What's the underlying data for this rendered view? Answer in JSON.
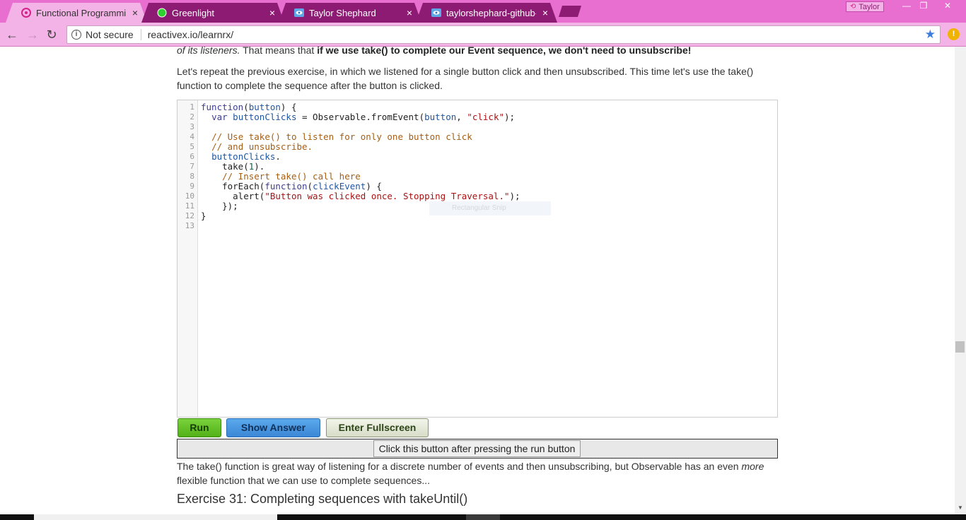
{
  "browser": {
    "tabs": [
      {
        "title": "Functional Programming",
        "active": true,
        "favicon": "reactivex-icon"
      },
      {
        "title": "Greenlight",
        "active": false,
        "favicon": "green-circle-icon"
      },
      {
        "title": "Taylor Shephard",
        "active": false,
        "favicon": "cloud-eye-icon"
      },
      {
        "title": "taylorshephard-github-io",
        "active": false,
        "favicon": "cloud-eye-icon"
      }
    ],
    "close_glyph": "×",
    "profile_name": "Taylor",
    "window_controls": {
      "minimize": "—",
      "restore": "❐",
      "close": "✕"
    },
    "security_label": "Not secure",
    "url": "reactivex.io/learnrx/",
    "colors": {
      "frame": "#e86fd0",
      "toolbar": "#f3b3e6",
      "inactive_tab": "#8e1b73"
    }
  },
  "page": {
    "top_paragraph": {
      "lead_italic": "of its listeners.",
      "middle": " That means that ",
      "bold": "if we use take() to complete our Event sequence, we don't need to unsubscribe!"
    },
    "intro": "Let's repeat the previous exercise, in which we listened for a single button click and then unsubscribed. This time let's use the take() function to complete the sequence after the button is clicked.",
    "editor": {
      "line_numbers": [
        "1",
        "2",
        "3",
        "4",
        "5",
        "6",
        "7",
        "8",
        "9",
        "10",
        "11",
        "12",
        "13"
      ],
      "overlay_text": "Rectangular Snip"
    },
    "buttons": {
      "run": "Run",
      "show_answer": "Show Answer",
      "fullscreen": "Enter Fullscreen"
    },
    "output_button": "Click this button after pressing the run button",
    "after_paragraph": {
      "text": "The take() function is great way of listening for a discrete number of events and then unsubscribing, but Observable has an even ",
      "italic": "more",
      "tail": " flexible function that we can use to complete sequences..."
    },
    "next_heading": "Exercise 31: Completing sequences with takeUntil()"
  }
}
